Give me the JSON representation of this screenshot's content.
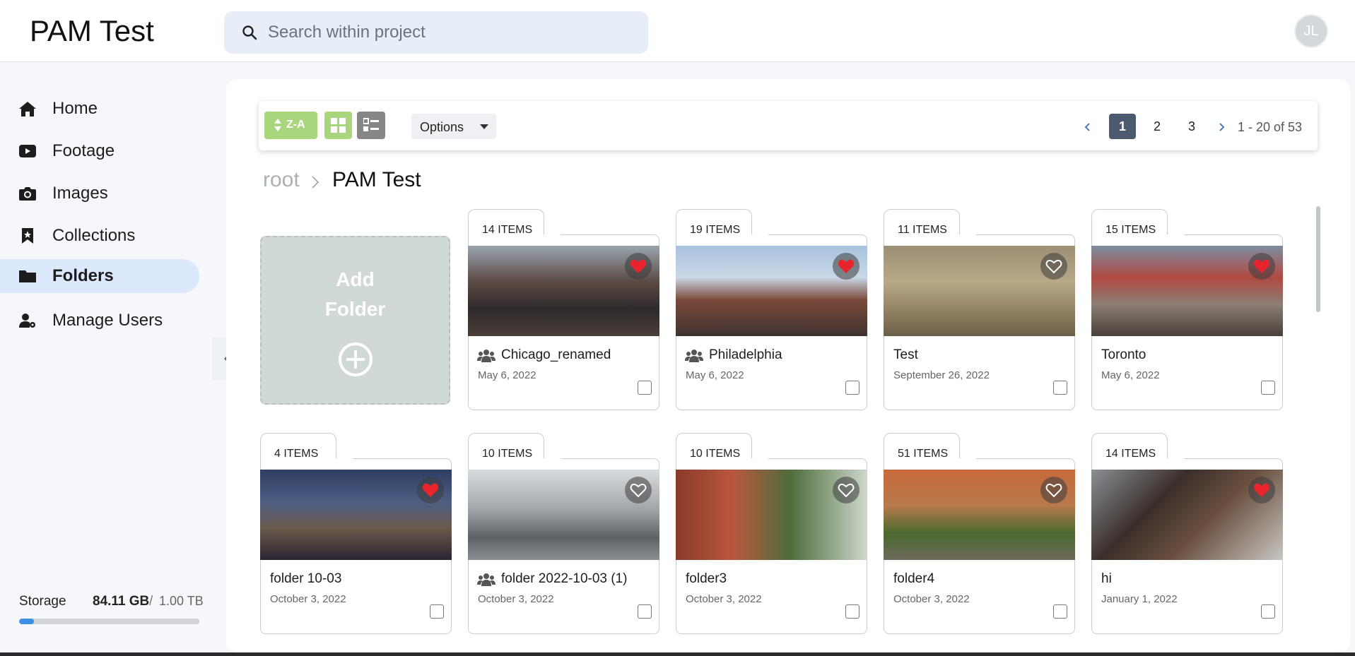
{
  "app": {
    "title": "PAM Test"
  },
  "search": {
    "placeholder": "Search within project"
  },
  "user": {
    "initials": "JL"
  },
  "sidebar": {
    "items": [
      {
        "label": "Home",
        "icon": "home-icon"
      },
      {
        "label": "Footage",
        "icon": "video-icon"
      },
      {
        "label": "Images",
        "icon": "camera-icon"
      },
      {
        "label": "Collections",
        "icon": "bookmark-icon"
      },
      {
        "label": "Folders",
        "icon": "folder-icon",
        "active": true
      },
      {
        "label": "Manage Users",
        "icon": "user-cog-icon"
      }
    ],
    "storage": {
      "label": "Storage",
      "used": "84.11 GB",
      "separator": "/",
      "total": "1.00 TB",
      "fraction_used": 0.084
    }
  },
  "toolbar": {
    "sort_label": "Z-A",
    "options_label": "Options",
    "pages": [
      "1",
      "2",
      "3"
    ],
    "current_page": "1",
    "range": "1 - 20 of 53",
    "colors": {
      "accent_green": "#a9d57c",
      "active_page": "#4b5a6e",
      "favorite_red": "#e8242c"
    }
  },
  "breadcrumb": {
    "root": "root",
    "current": "PAM Test"
  },
  "add_folder": {
    "line1": "Add",
    "line2": "Folder"
  },
  "folders": [
    {
      "items": "14 ITEMS",
      "name": "Chicago_renamed",
      "date": "May 6, 2022",
      "shared": true,
      "favorite": true
    },
    {
      "items": "19 ITEMS",
      "name": "Philadelphia",
      "date": "May 6, 2022",
      "shared": true,
      "favorite": true
    },
    {
      "items": "11 ITEMS",
      "name": "Test",
      "date": "September 26, 2022",
      "shared": false,
      "favorite": false
    },
    {
      "items": "15 ITEMS",
      "name": "Toronto",
      "date": "May 6, 2022",
      "shared": false,
      "favorite": true
    },
    {
      "items": "4 ITEMS",
      "name": "folder 10-03",
      "date": "October 3, 2022",
      "shared": false,
      "favorite": true
    },
    {
      "items": "10 ITEMS",
      "name": "folder 2022-10-03 (1)",
      "date": "October 3, 2022",
      "shared": true,
      "favorite": false
    },
    {
      "items": "10 ITEMS",
      "name": "folder3",
      "date": "October 3, 2022",
      "shared": false,
      "favorite": false
    },
    {
      "items": "51 ITEMS",
      "name": "folder4",
      "date": "October 3, 2022",
      "shared": false,
      "favorite": false
    },
    {
      "items": "14 ITEMS",
      "name": "hi",
      "date": "January 1, 2022",
      "shared": false,
      "favorite": true
    }
  ]
}
